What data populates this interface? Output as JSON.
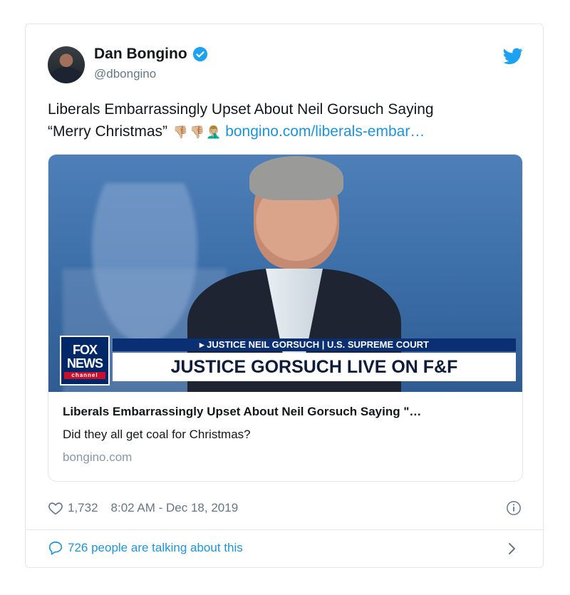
{
  "tweet": {
    "display_name": "Dan Bongino",
    "handle": "@dbongino",
    "text_line1": "Liberals Embarrassingly Upset About Neil Gorsuch Saying",
    "text_line2": "“Merry Christmas”",
    "emojis": [
      "👎🏼",
      "👎🏼",
      "🤦🏼‍♂️"
    ],
    "link_text": "bongino.com/liberals-embar…"
  },
  "link_card": {
    "image_banner_top": "▸ JUSTICE NEIL GORSUCH | U.S. SUPREME COURT",
    "image_banner_main": "JUSTICE GORSUCH LIVE ON F&F",
    "logo": [
      "FOX",
      "NEWS",
      "channel"
    ],
    "title": "Liberals Embarrassingly Upset About Neil Gorsuch Saying \"…",
    "description": "Did they all get coal for Christmas?",
    "domain": "bongino.com"
  },
  "meta": {
    "likes": "1,732",
    "timestamp": "8:02 AM - Dec 18, 2019"
  },
  "footer": {
    "talking": "726 people are talking about this"
  },
  "icons": {
    "verified": "verified-badge-icon",
    "bird": "twitter-bird-icon",
    "heart": "heart-icon",
    "info": "info-icon",
    "bubble": "speech-bubble-icon",
    "chevron": "chevron-right-icon"
  },
  "colors": {
    "link": "#1b95e0",
    "verified": "#1da1f2",
    "secondary_text": "#657786",
    "border": "#e1e8ed"
  }
}
